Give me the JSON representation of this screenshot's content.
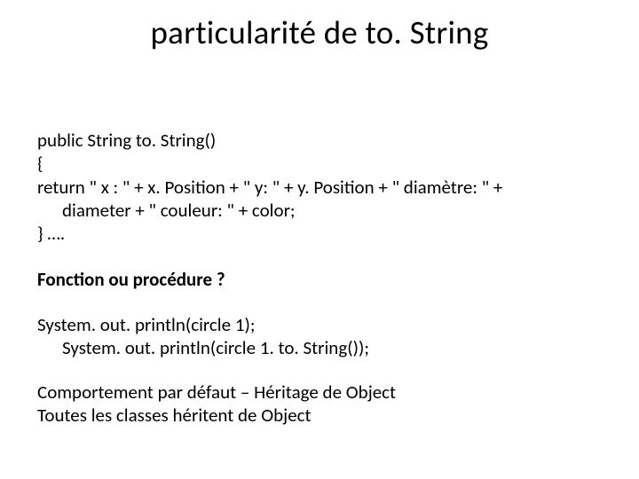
{
  "title": "particularité de to. String",
  "code": {
    "l1": "public String to. String()",
    "l2": "{",
    "l3a": "return \"  x : \" + x. Position + \" y: \"  + y. Position + \" diamètre: \"  +",
    "l3b": "diameter + \" couleur: \"  + color;",
    "l4": "} …. "
  },
  "question": "Fonction ou procédure ?",
  "example": {
    "l1": "System. out. println(circle 1);",
    "l2": "System. out. println(circle 1. to. String());"
  },
  "footer": {
    "l1": "Comportement par défaut – Héritage de Object",
    "l2": "Toutes les classes héritent de Object"
  }
}
